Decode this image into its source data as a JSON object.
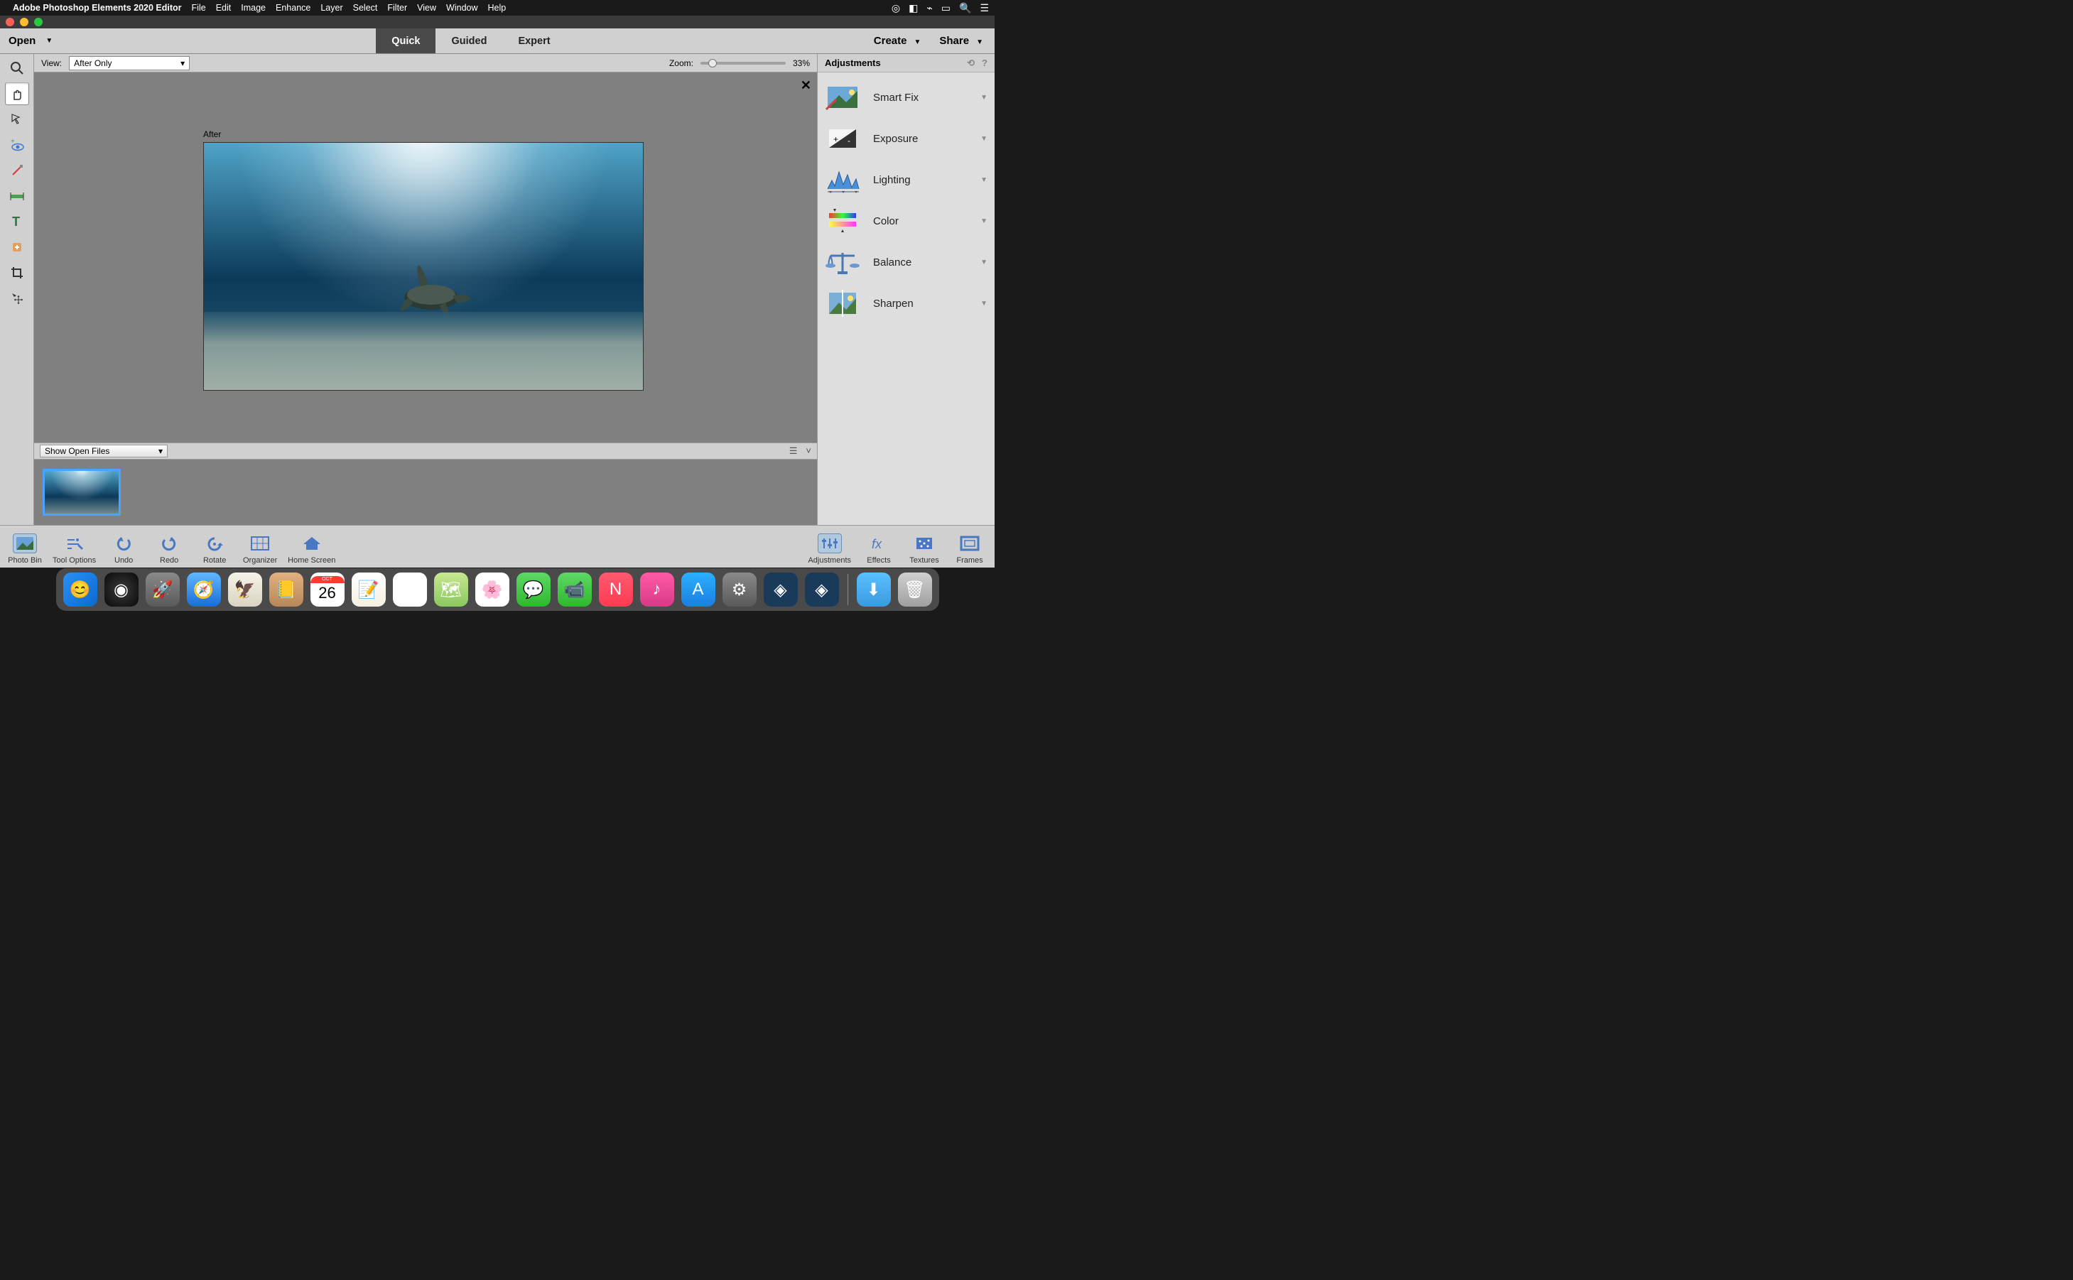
{
  "menubar": {
    "app_name": "Adobe Photoshop Elements 2020 Editor",
    "items": [
      "File",
      "Edit",
      "Image",
      "Enhance",
      "Layer",
      "Select",
      "Filter",
      "View",
      "Window",
      "Help"
    ]
  },
  "mode_bar": {
    "open_label": "Open",
    "tabs": [
      {
        "label": "Quick",
        "active": true
      },
      {
        "label": "Guided",
        "active": false
      },
      {
        "label": "Expert",
        "active": false
      }
    ],
    "create_label": "Create",
    "share_label": "Share"
  },
  "options_bar": {
    "view_label": "View:",
    "view_value": "After Only",
    "zoom_label": "Zoom:",
    "zoom_value": "33%",
    "zoom_frac": 0.1
  },
  "canvas": {
    "after_label": "After"
  },
  "bin_bar": {
    "select_value": "Show Open Files"
  },
  "adjustments_panel": {
    "title": "Adjustments",
    "items": [
      {
        "label": "Smart Fix",
        "icon": "smartfix"
      },
      {
        "label": "Exposure",
        "icon": "exposure"
      },
      {
        "label": "Lighting",
        "icon": "lighting"
      },
      {
        "label": "Color",
        "icon": "color"
      },
      {
        "label": "Balance",
        "icon": "balance"
      },
      {
        "label": "Sharpen",
        "icon": "sharpen"
      }
    ]
  },
  "action_bar": {
    "left": [
      {
        "label": "Photo Bin",
        "icon": "photobin",
        "selected": true
      },
      {
        "label": "Tool Options",
        "icon": "tooloptions",
        "selected": false
      },
      {
        "label": "Undo",
        "icon": "undo",
        "selected": false
      },
      {
        "label": "Redo",
        "icon": "redo",
        "selected": false
      },
      {
        "label": "Rotate",
        "icon": "rotate",
        "selected": false
      },
      {
        "label": "Organizer",
        "icon": "organizer",
        "selected": false
      },
      {
        "label": "Home Screen",
        "icon": "home",
        "selected": false
      }
    ],
    "right": [
      {
        "label": "Adjustments",
        "icon": "adjustments",
        "selected": true
      },
      {
        "label": "Effects",
        "icon": "effects",
        "selected": false
      },
      {
        "label": "Textures",
        "icon": "textures",
        "selected": false
      },
      {
        "label": "Frames",
        "icon": "frames",
        "selected": false
      }
    ]
  },
  "dock": {
    "calendar_text": "26",
    "calendar_month": "OCT"
  }
}
